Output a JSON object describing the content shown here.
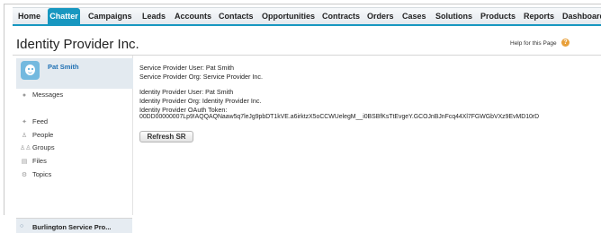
{
  "tabs": [
    {
      "label": "Home",
      "active": false
    },
    {
      "label": "Chatter",
      "active": true
    },
    {
      "label": "Campaigns",
      "active": false
    },
    {
      "label": "Leads",
      "active": false
    },
    {
      "label": "Accounts",
      "active": false
    },
    {
      "label": "Contacts",
      "active": false
    },
    {
      "label": "Opportunities",
      "active": false
    },
    {
      "label": "Contracts",
      "active": false
    },
    {
      "label": "Orders",
      "active": false
    },
    {
      "label": "Cases",
      "active": false
    },
    {
      "label": "Solutions",
      "active": false
    },
    {
      "label": "Products",
      "active": false
    },
    {
      "label": "Reports",
      "active": false
    },
    {
      "label": "Dashboards",
      "active": false
    }
  ],
  "header": {
    "title": "Identity Provider Inc.",
    "help_label": "Help for this Page",
    "help_icon": "question-icon"
  },
  "sidebar": {
    "user_name": "Pat Smith",
    "messages_label": "Messages",
    "items": [
      {
        "label": "Feed",
        "icon": "feed-icon"
      },
      {
        "label": "People",
        "icon": "person-icon"
      },
      {
        "label": "Groups",
        "icon": "groups-icon"
      },
      {
        "label": "Files",
        "icon": "file-icon"
      },
      {
        "label": "Topics",
        "icon": "topics-icon"
      }
    ],
    "bottom_item": "Burlington Service Pro..."
  },
  "main": {
    "sp_user": "Service Provider User: Pat Smith",
    "sp_org": "Service Provider Org: Service Provider Inc.",
    "idp_user": "Identity Provider User: Pat Smith",
    "idp_org": "Identity Provider Org: Identity Provider Inc.",
    "idp_token_label": "Identity Provider OAuth Token:",
    "idp_token_value": "00DD00000007Lp9!AQQAQNaaw5q7leJg9pbDT1kVE.a6irktzX5oCCWUelegM__i0BSBfKsTtEvgeY.GCOJnBJnFcq44Xl7FGWGbVXz9EvMD10rD",
    "refresh_label": "Refresh SR"
  },
  "colors": {
    "accent": "#1797c0",
    "link": "#1f70b3",
    "help": "#e8a03a"
  }
}
